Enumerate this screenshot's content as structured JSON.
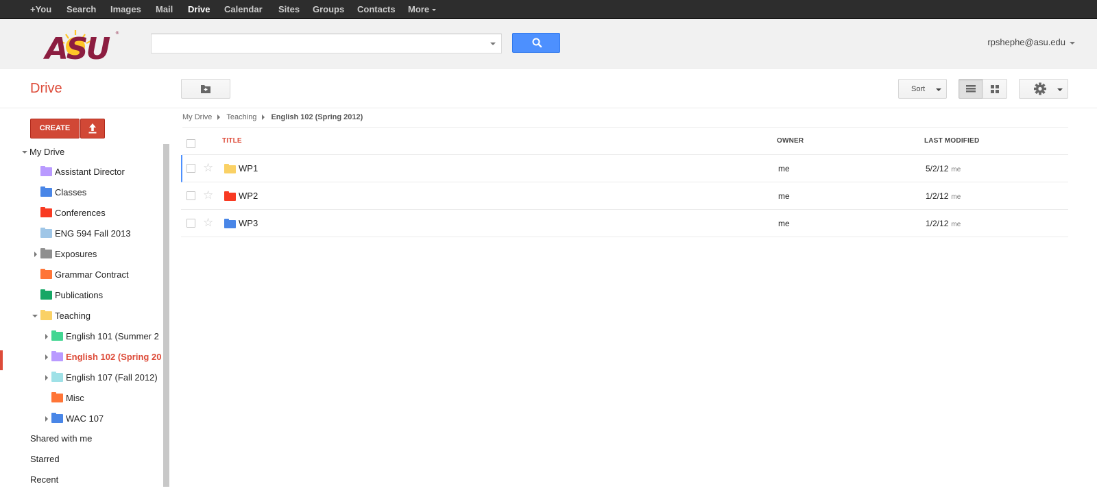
{
  "topbar": {
    "items": [
      "+You",
      "Search",
      "Images",
      "Mail",
      "Drive",
      "Calendar",
      "Sites",
      "Groups",
      "Contacts",
      "More"
    ],
    "active": "Drive"
  },
  "header": {
    "logo_text": "ASU",
    "search_value": "",
    "user_email": "rpshephe@asu.edu"
  },
  "toolbar": {
    "app_title": "Drive",
    "sort_label": "Sort"
  },
  "sidebar": {
    "create_label": "CREATE",
    "root": "My Drive",
    "folders": [
      {
        "label": "Assistant Director",
        "color": "#b99aff"
      },
      {
        "label": "Classes",
        "color": "#4986e7"
      },
      {
        "label": "Conferences",
        "color": "#f83a22"
      },
      {
        "label": "ENG 594 Fall 2013",
        "color": "#9fc6e7",
        "shared": true
      },
      {
        "label": "Exposures",
        "color": "#8f8f8f",
        "expandable": true
      },
      {
        "label": "Grammar Contract",
        "color": "#ff7537"
      },
      {
        "label": "Publications",
        "color": "#16a765"
      },
      {
        "label": "Teaching",
        "color": "#fad165",
        "expanded": true
      },
      {
        "label": "English 101 (Summer 2",
        "color": "#42d692",
        "expandable": true,
        "child": true
      },
      {
        "label": "English 102 (Spring 20",
        "color": "#b99aff",
        "expandable": true,
        "child": true,
        "selected": true
      },
      {
        "label": "English 107 (Fall 2012)",
        "color": "#9fe1e7",
        "expandable": true,
        "child": true
      },
      {
        "label": "Misc",
        "color": "#ff7537",
        "child": true
      },
      {
        "label": "WAC 107",
        "color": "#4986e7",
        "expandable": true,
        "child": true
      }
    ],
    "shared_with_me": "Shared with me",
    "starred": "Starred",
    "recent": "Recent"
  },
  "breadcrumb": [
    "My Drive",
    "Teaching",
    "English 102 (Spring 2012)"
  ],
  "table": {
    "headers": {
      "title": "TITLE",
      "owner": "OWNER",
      "modified": "LAST MODIFIED"
    },
    "rows": [
      {
        "name": "WP1",
        "color": "#fad165",
        "owner": "me",
        "modified": "5/2/12",
        "modified_by": "me"
      },
      {
        "name": "WP2",
        "color": "#f83a22",
        "owner": "me",
        "modified": "1/2/12",
        "modified_by": "me"
      },
      {
        "name": "WP3",
        "color": "#4986e7",
        "owner": "me",
        "modified": "1/2/12",
        "modified_by": "me"
      }
    ]
  }
}
